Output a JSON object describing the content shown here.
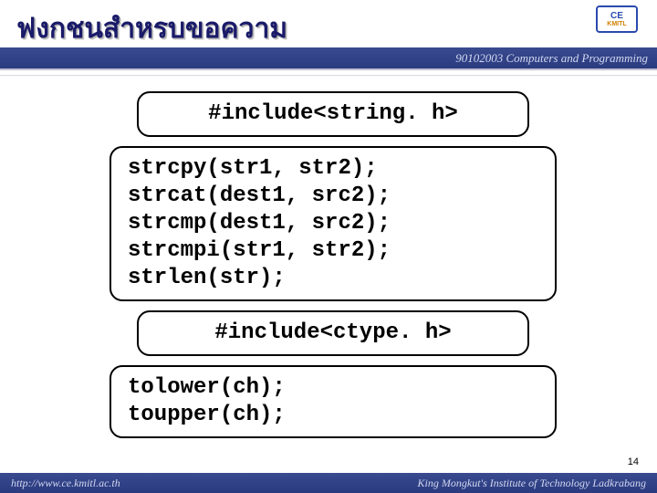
{
  "title": "ฟงกชนสำหรบขอความ",
  "header": {
    "course": "90102003 Computers and Programming"
  },
  "logo": {
    "line1": "CE",
    "line2": "KMITL"
  },
  "boxes": {
    "include1": "#include<string. h>",
    "string_funcs": [
      "strcpy(str1, str2);",
      "strcat(dest1, src2);",
      "strcmp(dest1, src2);",
      "strcmpi(str1, str2);",
      "strlen(str);"
    ],
    "include2": "#include<ctype. h>",
    "ctype_funcs": [
      "tolower(ch);",
      "toupper(ch);"
    ]
  },
  "page_number": "14",
  "footer": {
    "url": "http://www.ce.kmitl.ac.th",
    "institution": "King Mongkut's Institute of Technology Ladkrabang"
  }
}
